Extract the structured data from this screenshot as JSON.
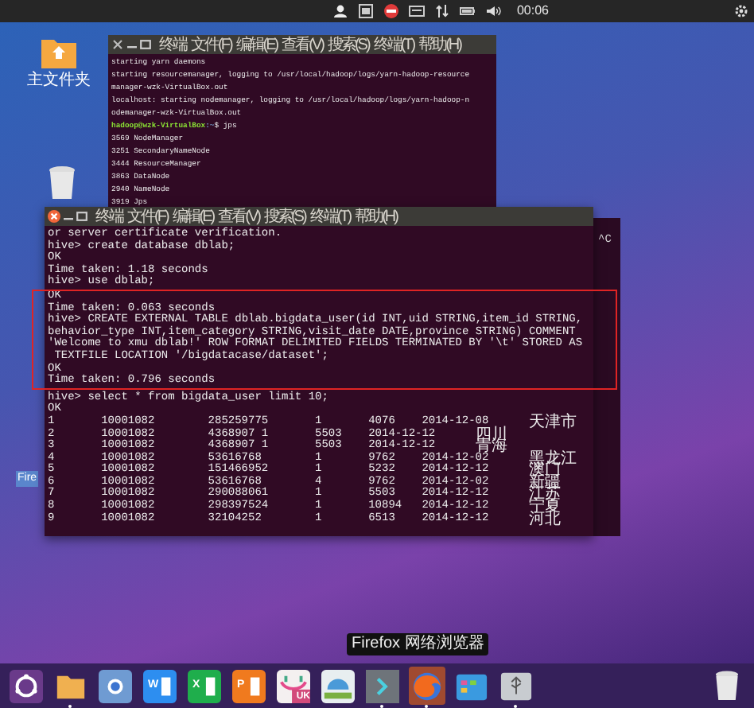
{
  "top_bar": {
    "clock": "00:06"
  },
  "desktop": {
    "folder_label": "主文件夹",
    "tooltip_fragment": "Fire"
  },
  "terminals": [
    {
      "focused": false,
      "menu": [
        "终端",
        "文件(F)",
        "编辑(E)",
        "查看(V)",
        "搜索(S)",
        "终端(T)",
        "帮助(H)"
      ],
      "lines": [
        {
          "kind": "output",
          "text": "starting yarn daemons"
        },
        {
          "kind": "output",
          "text": "starting resourcemanager, logging to /usr/local/hadoop/logs/yarn-hadoop-resource"
        },
        {
          "kind": "output",
          "text": "manager-wzk-VirtualBox.out"
        },
        {
          "kind": "output",
          "text": "localhost: starting nodemanager, logging to /usr/local/hadoop/logs/yarn-hadoop-n"
        },
        {
          "kind": "output",
          "text": "odemanager-wzk-VirtualBox.out"
        },
        {
          "kind": "prompt",
          "user": "hadoop@wzk-VirtualBox",
          "path": ":~",
          "command": "$ jps"
        },
        {
          "kind": "output",
          "text": "3569 NodeManager"
        },
        {
          "kind": "output",
          "text": "3251 SecondaryNameNode"
        },
        {
          "kind": "output",
          "text": "3444 ResourceManager"
        },
        {
          "kind": "output",
          "text": "3863 DataNode"
        },
        {
          "kind": "output",
          "text": "2940 NameNode"
        },
        {
          "kind": "output",
          "text": "3919 Jps"
        }
      ]
    },
    {
      "focused": true,
      "menu": [
        "终端",
        "文件(F)",
        "编辑(E)",
        "查看(V)",
        "搜索(S)",
        "终端(T)",
        "帮助(H)"
      ],
      "lines": [
        {
          "kind": "output",
          "text": "or server certificate verification."
        },
        {
          "kind": "output",
          "text": "hive> create database dblab;"
        },
        {
          "kind": "output",
          "text": "OK"
        },
        {
          "kind": "output",
          "text": "Time taken: 1.18 seconds"
        },
        {
          "kind": "output",
          "text": "hive> use dblab;"
        },
        {
          "kind": "highlight_box",
          "lines": [
            {
              "kind": "output",
              "text": "OK"
            },
            {
              "kind": "output",
              "text": "Time taken: 0.063 seconds"
            },
            {
              "kind": "output",
              "text": "hive> CREATE EXTERNAL TABLE dblab.bigdata_user(id INT,uid STRING,item_id STRING,"
            },
            {
              "kind": "output",
              "text": "behavior_type INT,item_category STRING,visit_date DATE,province STRING) COMMENT"
            },
            {
              "kind": "output",
              "text": "'Welcome to xmu dblab!' ROW FORMAT DELIMITED FIELDS TERMINATED BY '\\t' STORED AS"
            },
            {
              "kind": "output",
              "text": " TEXTFILE LOCATION '/bigdatacase/dataset';"
            },
            {
              "kind": "output",
              "text": "OK"
            },
            {
              "kind": "output",
              "text": "Time taken: 0.796 seconds"
            }
          ]
        },
        {
          "kind": "output",
          "text": "hive> select * from bigdata_user limit 10;"
        },
        {
          "kind": "output",
          "text": "OK"
        }
      ],
      "result_rows": [
        [
          "1",
          "10001082",
          "285259775",
          "1",
          "4076",
          "2014-12-08",
          "天津市"
        ],
        [
          "2",
          "10001082",
          "4368907 1",
          "5503",
          "2014-12-12",
          "四川"
        ],
        [
          "3",
          "10001082",
          "4368907 1",
          "5503",
          "2014-12-12",
          "青海"
        ],
        [
          "4",
          "10001082",
          "53616768",
          "1",
          "9762",
          "2014-12-02",
          "黑龙江"
        ],
        [
          "5",
          "10001082",
          "151466952",
          "1",
          "5232",
          "2014-12-12",
          "澳门"
        ],
        [
          "6",
          "10001082",
          "53616768",
          "4",
          "9762",
          "2014-12-02",
          "新疆"
        ],
        [
          "7",
          "10001082",
          "290088061",
          "1",
          "5503",
          "2014-12-12",
          "江苏"
        ],
        [
          "8",
          "10001082",
          "298397524",
          "1",
          "10894",
          "2014-12-12",
          "宁夏"
        ],
        [
          "9",
          "10001082",
          "32104252",
          "1",
          "6513",
          "2014-12-12",
          "河北"
        ]
      ]
    }
  ],
  "background_window": {
    "text": "^C"
  },
  "dock": {
    "tooltip": "Firefox 网络浏览器",
    "items": [
      {
        "kind": "ubuntu",
        "running": false,
        "hovered": false
      },
      {
        "kind": "folder",
        "running": true,
        "hovered": false
      },
      {
        "kind": "chrome",
        "running": false,
        "hovered": false
      },
      {
        "kind": "writer",
        "badge": "W",
        "running": false,
        "hovered": false
      },
      {
        "kind": "calc",
        "badge": "X",
        "running": false,
        "hovered": false
      },
      {
        "kind": "impress",
        "badge": "P",
        "running": false,
        "hovered": false
      },
      {
        "kind": "store",
        "badge": "UK",
        "running": false,
        "hovered": false
      },
      {
        "kind": "dome",
        "running": false,
        "hovered": false
      },
      {
        "kind": "terminal",
        "running": true,
        "hovered": false
      },
      {
        "kind": "firefox",
        "running": true,
        "hovered": true
      },
      {
        "kind": "files",
        "running": false,
        "hovered": false
      },
      {
        "kind": "usb",
        "running": true,
        "hovered": false
      }
    ]
  }
}
